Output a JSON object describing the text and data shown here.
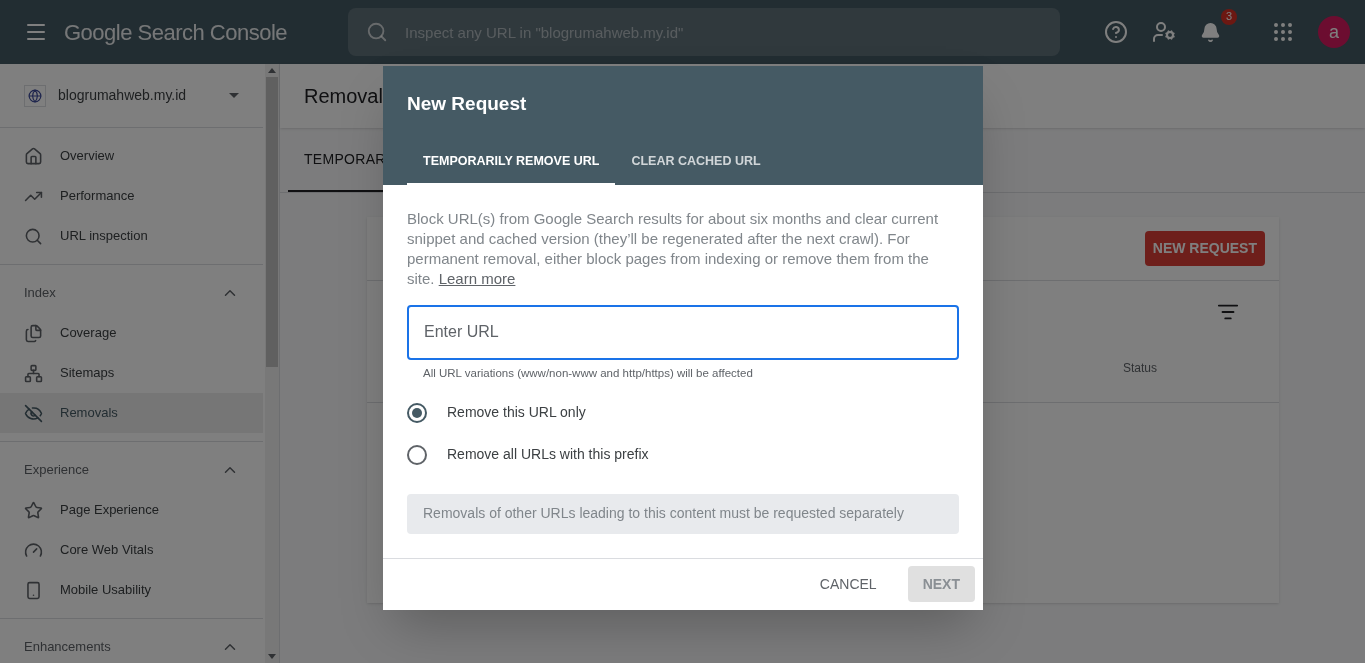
{
  "header": {
    "product": "Google Search Console",
    "search": {
      "placeholder": "Inspect any URL in \"blogrumahweb.my.id\""
    },
    "notification_count": "3",
    "avatar": "a"
  },
  "sidebar": {
    "property": "blogrumahweb.my.id",
    "sections": [
      {
        "items": [
          {
            "label": "Overview",
            "selected": false
          },
          {
            "label": "Performance",
            "selected": false
          },
          {
            "label": "URL inspection",
            "selected": false
          }
        ]
      },
      {
        "heading": "Index",
        "expanded": true,
        "items": [
          {
            "label": "Coverage",
            "selected": false
          },
          {
            "label": "Sitemaps",
            "selected": false
          },
          {
            "label": "Removals",
            "selected": true
          }
        ]
      },
      {
        "heading": "Experience",
        "expanded": true,
        "items": [
          {
            "label": "Page Experience",
            "selected": false
          },
          {
            "label": "Core Web Vitals",
            "selected": false
          },
          {
            "label": "Mobile Usability",
            "selected": false
          }
        ]
      },
      {
        "heading": "Enhancements",
        "expanded": true
      }
    ]
  },
  "main": {
    "title": "Removal",
    "tabs": [
      {
        "label": "TEMPORAR",
        "selected": true
      }
    ],
    "card": {
      "button": "NEW REQUEST",
      "columns": [
        "Status"
      ]
    }
  },
  "dialog": {
    "title": "New Request",
    "tabs": [
      {
        "label": "TEMPORARILY REMOVE URL",
        "selected": true
      },
      {
        "label": "CLEAR CACHED URL",
        "selected": false
      }
    ],
    "description": "Block URL(s) from Google Search results for about six months and clear current snippet and cached version (they’ll be regenerated after the next crawl). For permanent removal, either block pages from indexing or remove them from the site.",
    "link": "Learn more",
    "url_field": {
      "placeholder": "Enter URL",
      "focused": true
    },
    "hint": "All URL variations (www/non-www and http/https) will be affected",
    "options": [
      {
        "label": "Remove this URL only",
        "selected": true
      },
      {
        "label": "Remove all URLs with this prefix",
        "selected": false
      }
    ],
    "note": "Removals of other URLs leading to this content must be requested separately",
    "buttons": [
      {
        "label": "CANCEL",
        "disabled": false
      },
      {
        "label": "NEXT",
        "disabled": true
      }
    ]
  }
}
